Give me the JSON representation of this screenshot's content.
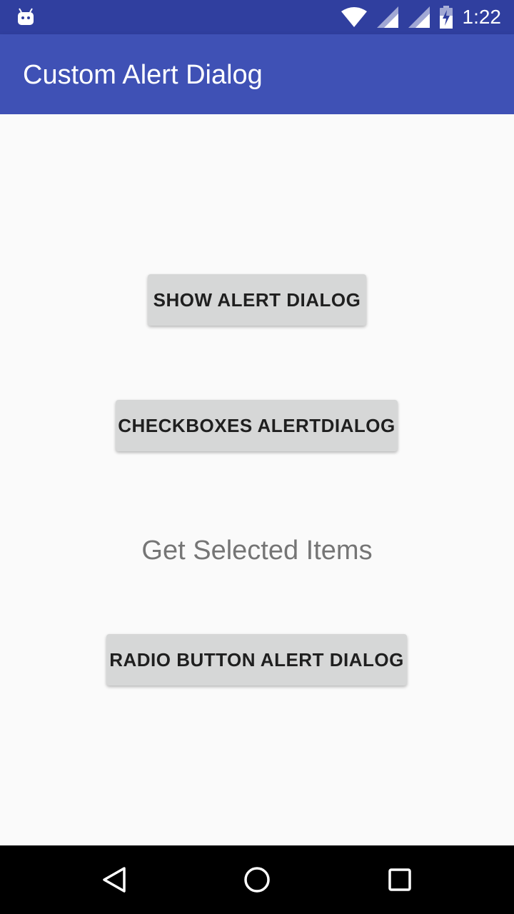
{
  "status_bar": {
    "time": "1:22",
    "icons": [
      "android-notification-icon",
      "wifi-icon",
      "signal-icon",
      "signal-icon-2",
      "battery-charging-icon"
    ]
  },
  "app_bar": {
    "title": "Custom Alert Dialog"
  },
  "main": {
    "show_alert_button": "SHOW ALERT DIALOG",
    "checkboxes_button": "CHECKBOXES ALERTDIALOG",
    "selected_items_text": "Get Selected Items",
    "radio_button": "RADIO BUTTON ALERT DIALOG"
  },
  "nav_bar": {
    "icons": [
      "back-icon",
      "home-icon",
      "recent-apps-icon"
    ]
  },
  "colors": {
    "status_bar": "#303f9f",
    "app_bar": "#3f51b5",
    "button_bg": "#d6d7d7",
    "background": "#fafafa"
  }
}
